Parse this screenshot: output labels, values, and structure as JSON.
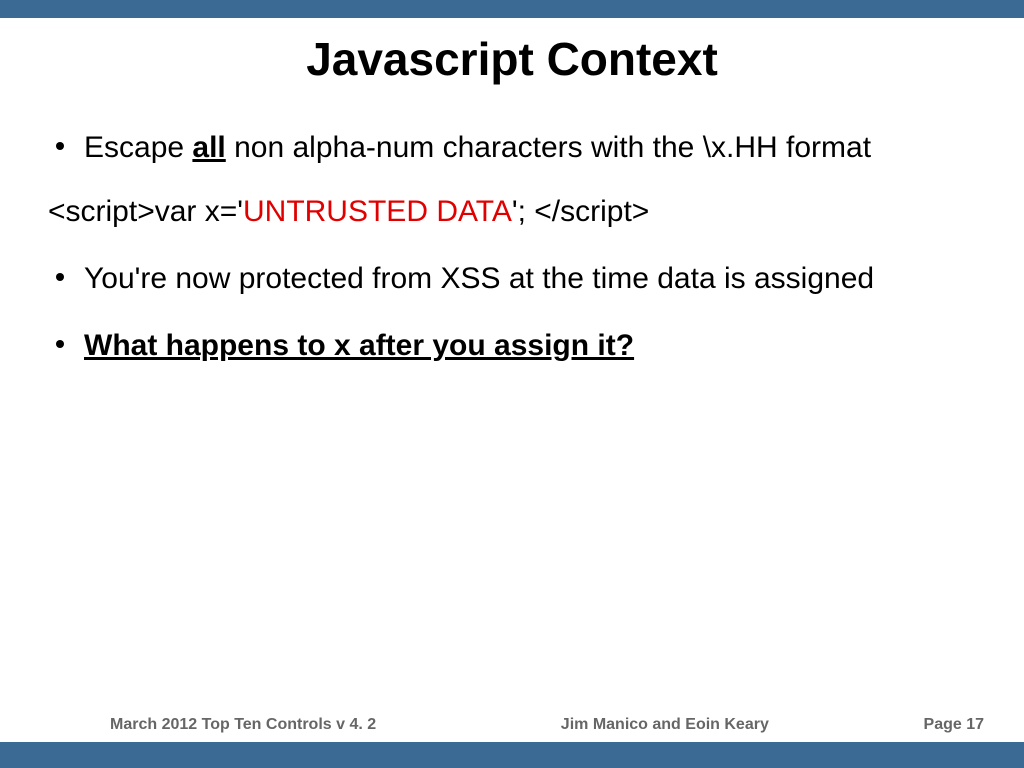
{
  "title": "Javascript Context",
  "bullets": {
    "b1_pre": "Escape ",
    "b1_all": "all",
    "b1_post": " non alpha-num characters with the \\x.HH format",
    "b2": "You're now protected from XSS at the time data is assigned",
    "b3": "What happens to x after you assign it?"
  },
  "code": {
    "pre": "<script>var x='",
    "red": "UNTRUSTED DATA",
    "post": "'; </script>"
  },
  "footer": {
    "left": "March 2012  Top Ten Controls v 4. 2",
    "center": "Jim Manico and Eoin Keary",
    "right": "Page 17"
  }
}
